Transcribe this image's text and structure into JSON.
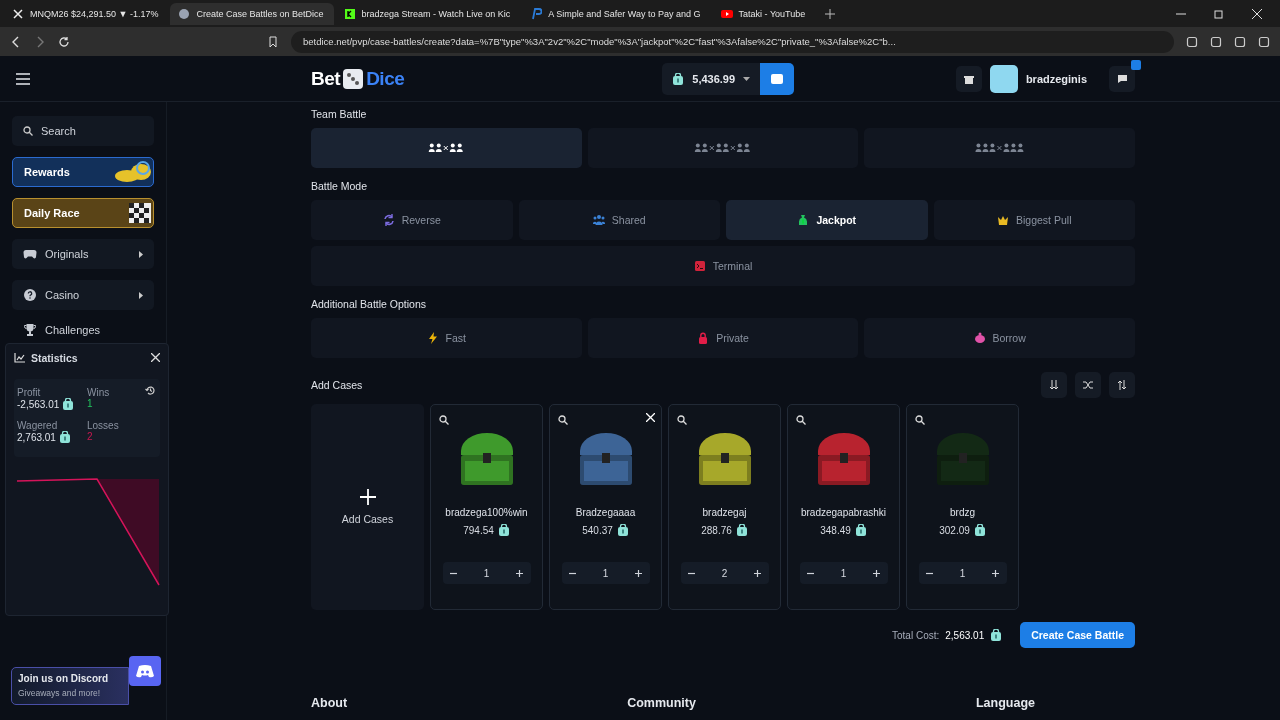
{
  "browser": {
    "tabs": [
      {
        "title": "MNQM26 $24,291.50 ▼ -1.17%",
        "selected": false,
        "kind": "x"
      },
      {
        "title": "Create Case Battles on BetDice",
        "selected": true,
        "kind": "dice"
      },
      {
        "title": "bradzega Stream - Watch Live on Kic",
        "selected": false,
        "kind": "kick"
      },
      {
        "title": "A Simple and Safer Way to Pay and G",
        "selected": false,
        "kind": "paypal"
      },
      {
        "title": "Tataki - YouTube",
        "selected": false,
        "kind": "youtube"
      }
    ],
    "url": "betdice.net/pvp/case-battles/create?data=%7B\"type\"%3A\"2v2\"%2C\"mode\"%3A\"jackpot\"%2C\"fast\"%3Afalse%2C\"private_\"%3Afalse%2C\"b..."
  },
  "header": {
    "logo_left": "Bet",
    "logo_right": "Dice",
    "balance": "5,436.99",
    "username": "bradzeginis"
  },
  "sidebar": {
    "search": {
      "placeholder": "Search"
    },
    "promos": [
      {
        "label": "Rewards",
        "kind": "rewards"
      },
      {
        "label": "Daily Race",
        "kind": "race"
      }
    ],
    "items": [
      {
        "label": "Originals",
        "kind": "gamepad",
        "has_submenu": true
      },
      {
        "label": "Casino",
        "kind": "chip",
        "has_submenu": true
      },
      {
        "label": "Challenges",
        "kind": "trophy",
        "has_submenu": false
      }
    ],
    "discord": {
      "title": "Join us on Discord",
      "subtitle": "Giveaways and more!"
    }
  },
  "statistics": {
    "title": "Statistics",
    "profit_label": "Profit",
    "profit": "-2,563.01",
    "wins_label": "Wins",
    "wins": "1",
    "wagered_label": "Wagered",
    "wagered": "2,763.01",
    "losses_label": "Losses",
    "losses": "2"
  },
  "team_battle": {
    "title": "Team Battle",
    "options": [
      {
        "kind": "duo-duo",
        "selected": true
      },
      {
        "kind": "duo-duo-duo",
        "selected": false
      },
      {
        "kind": "trio-trio",
        "selected": false
      }
    ]
  },
  "battle_mode": {
    "title": "Battle Mode",
    "modes": [
      {
        "label": "Reverse",
        "kind": "reverse",
        "selected": false
      },
      {
        "label": "Shared",
        "kind": "shared",
        "selected": false
      },
      {
        "label": "Jackpot",
        "kind": "jackpot",
        "selected": true
      },
      {
        "label": "Biggest Pull",
        "kind": "crown",
        "selected": false
      },
      {
        "label": "Terminal",
        "kind": "terminal",
        "selected": false
      }
    ]
  },
  "additional_options": {
    "title": "Additional Battle Options",
    "options": [
      {
        "label": "Fast",
        "kind": "bolt",
        "selected": false
      },
      {
        "label": "Private",
        "kind": "lock",
        "selected": false
      },
      {
        "label": "Borrow",
        "kind": "piggy",
        "selected": false
      }
    ]
  },
  "cases": {
    "title": "Add Cases",
    "add_label": "Add Cases",
    "items": [
      {
        "name": "bradzega100%win",
        "price": "794.54",
        "quantity": "1",
        "color": "#3f9a2c",
        "show_remove": false
      },
      {
        "name": "Bradzegaaaa",
        "price": "540.37",
        "quantity": "1",
        "color": "#3d6496",
        "show_remove": true
      },
      {
        "name": "bradzegaj",
        "price": "288.76",
        "quantity": "2",
        "color": "#a7a82a",
        "show_remove": false
      },
      {
        "name": "bradzegapabrashki",
        "price": "348.49",
        "quantity": "1",
        "color": "#b8232f",
        "show_remove": false
      },
      {
        "name": "brdzg",
        "price": "302.09",
        "quantity": "1",
        "color": "#132915",
        "show_remove": false
      }
    ],
    "total_label": "Total Cost:",
    "total": "2,563.01",
    "create_button": "Create Case Battle"
  },
  "footer": {
    "headings": [
      "About",
      "Community",
      "Language"
    ]
  }
}
